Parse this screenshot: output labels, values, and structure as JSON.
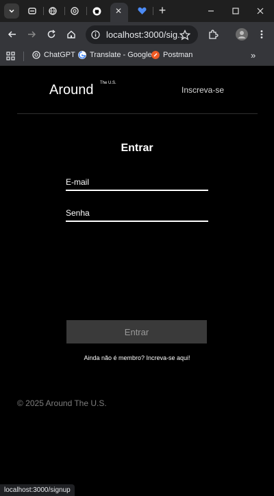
{
  "browser": {
    "url_display": "localhost:3000/sig...",
    "bookmarks": [
      "ChatGPT",
      "Translate - Google",
      "Postman"
    ],
    "status_url": "localhost:3000/signup"
  },
  "header": {
    "logo_main": "Around",
    "logo_sup": "The U.S.",
    "signup_link": "Inscreva-se"
  },
  "form": {
    "title": "Entrar",
    "email_placeholder": "E-mail",
    "password_placeholder": "Senha",
    "submit_label": "Entrar",
    "member_text": "Ainda não é membro? Increva-se aqui!"
  },
  "footer": {
    "copyright": "© 2025 Around The U.S."
  },
  "colors": {
    "page_bg": "#000000",
    "button_bg": "#3a3a3a",
    "footer_text": "#7d7d7d"
  }
}
